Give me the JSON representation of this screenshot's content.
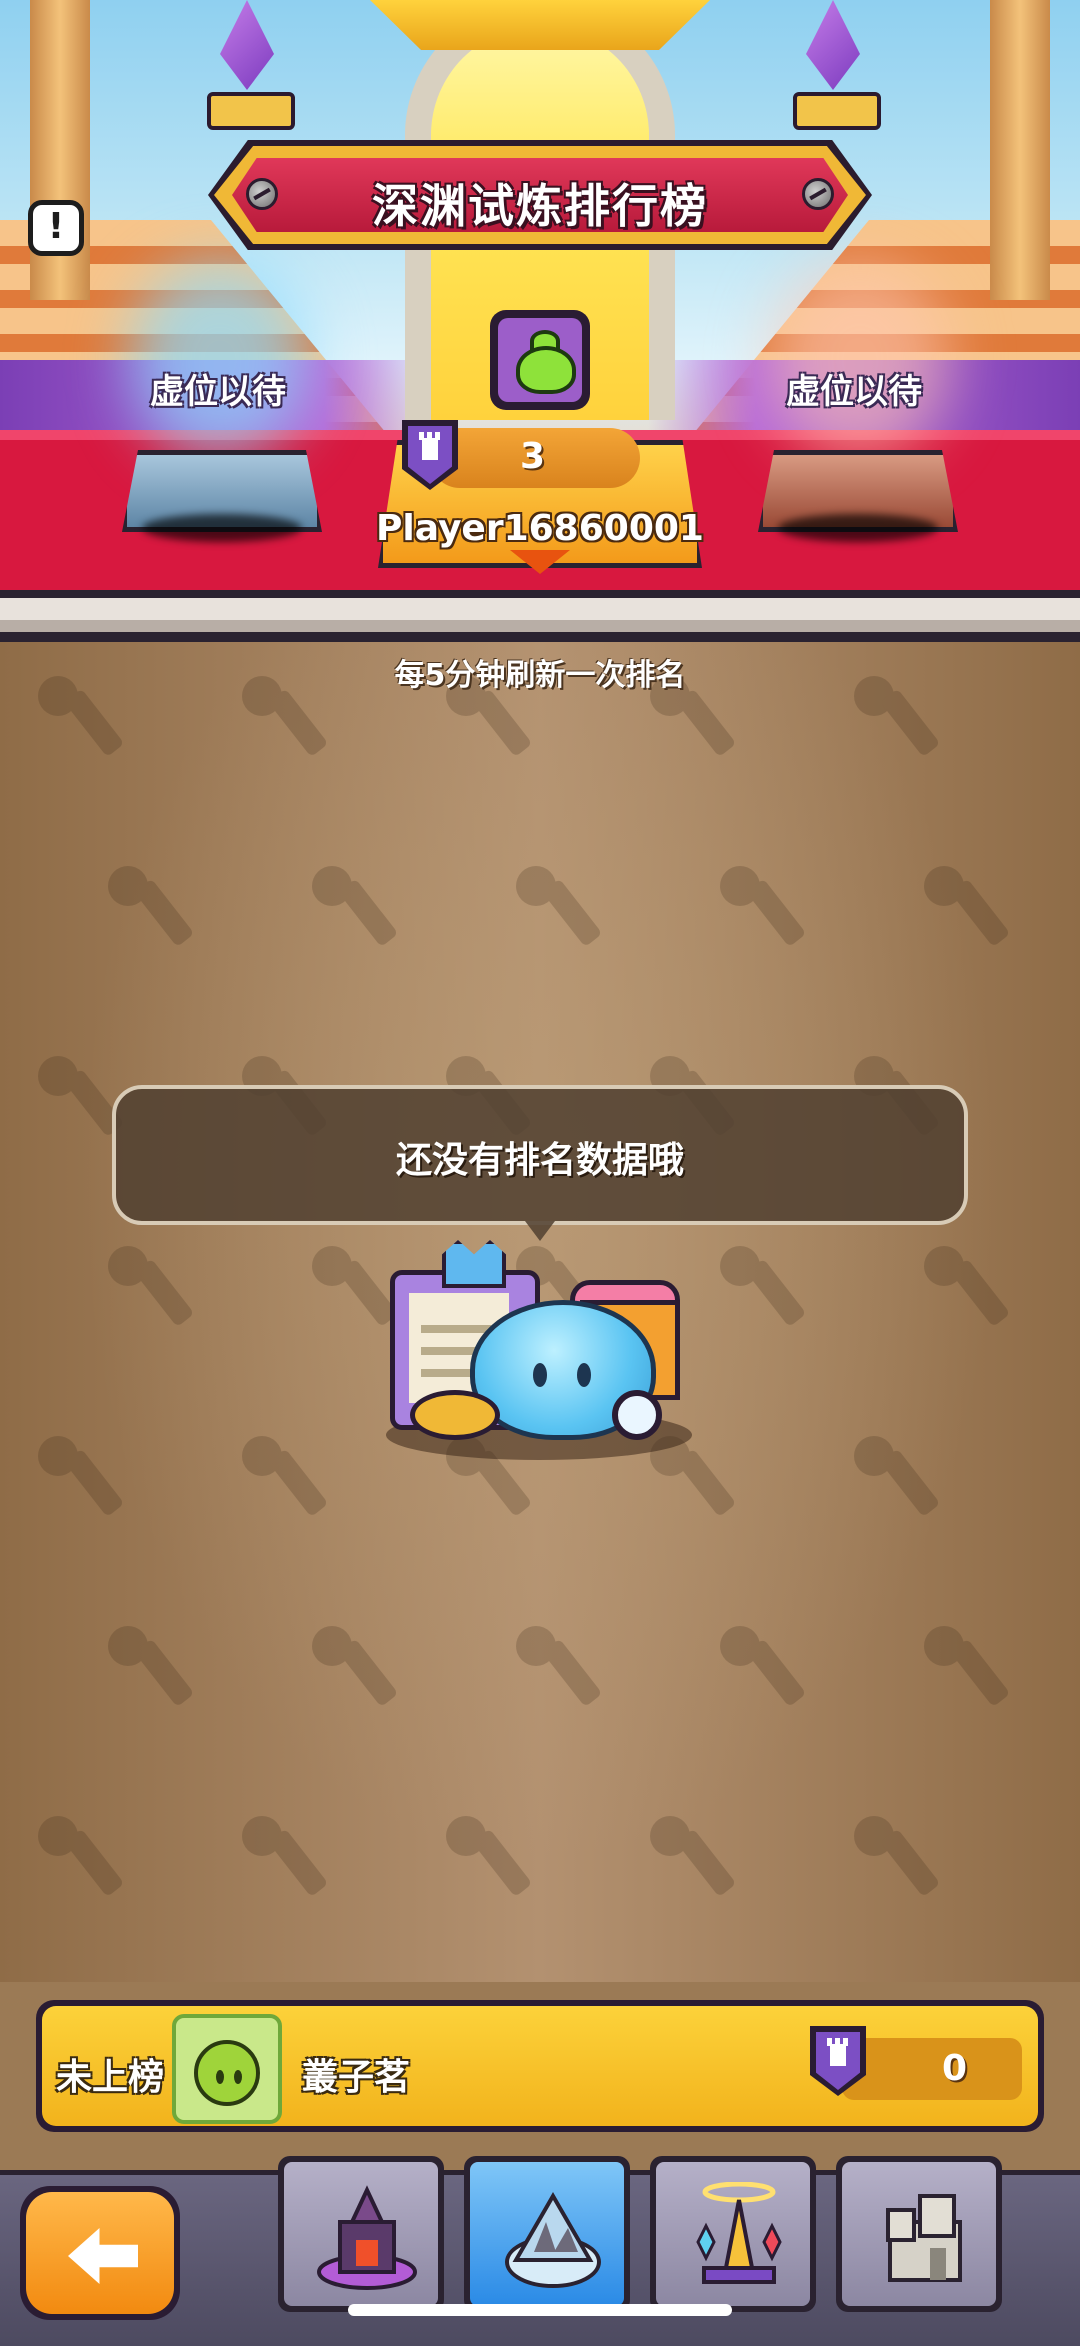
{
  "header": {
    "title": "深渊试炼排行榜"
  },
  "podium": {
    "left_label": "虚位以待",
    "right_label": "虚位以待",
    "center": {
      "rank_value": "3",
      "player_name": "Player16860001"
    }
  },
  "main": {
    "refresh_note": "每5分钟刷新一次排名",
    "empty_message": "还没有排名数据哦"
  },
  "my_rank": {
    "status": "未上榜",
    "name": "叢子茗",
    "score": "0"
  },
  "nav": {
    "tabs": [
      {
        "icon": "lava-tower-icon",
        "active": false
      },
      {
        "icon": "ice-mountain-icon",
        "active": true
      },
      {
        "icon": "golden-tower-icon",
        "active": false
      },
      {
        "icon": "stone-castle-icon",
        "active": false
      }
    ]
  },
  "colors": {
    "banner_red": "#d02648",
    "banner_gold": "#f0b836",
    "carpet": "#d8183f",
    "my_bar": "#f6be24",
    "back_button": "#f59a1e",
    "active_tab": "#2a8ae6"
  }
}
